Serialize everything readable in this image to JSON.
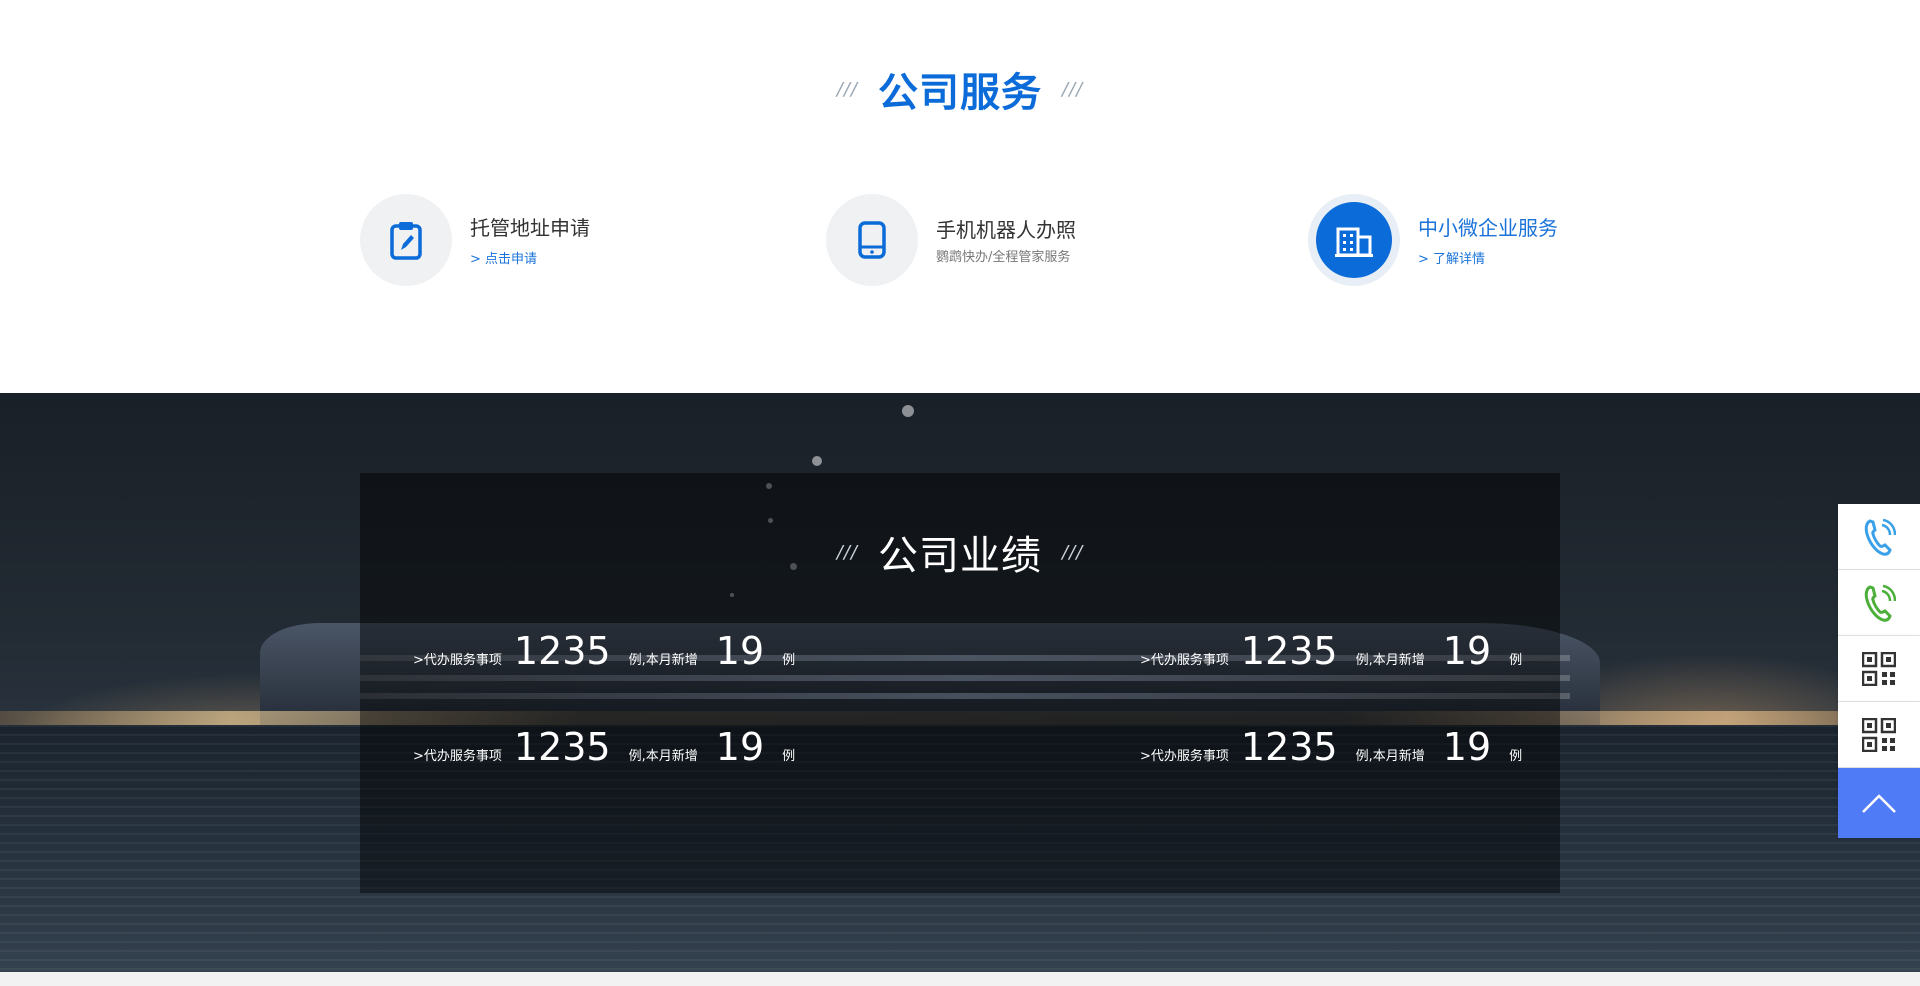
{
  "services": {
    "title": "公司服务",
    "slashes": "///",
    "items": [
      {
        "title": "托管地址申请",
        "link": "> 点击申请",
        "icon": "clipboard-pen-icon"
      },
      {
        "title": "手机机器人办照",
        "subtitle": "鹦鹉快办/全程管家服务",
        "icon": "tablet-icon"
      },
      {
        "title": "中小微企业服务",
        "link": "> 了解详情",
        "icon": "building-icon"
      }
    ]
  },
  "performance": {
    "title": "公司业绩",
    "slashes": "///",
    "stats": [
      {
        "label": ">代办服务事项",
        "total": "1235",
        "mid": "例,本月新增",
        "new": "19",
        "unit": "例"
      },
      {
        "label": ">代办服务事项",
        "total": "1235",
        "mid": "例,本月新增",
        "new": "19",
        "unit": "例"
      },
      {
        "label": ">代办服务事项",
        "total": "1235",
        "mid": "例,本月新增",
        "new": "19",
        "unit": "例"
      },
      {
        "label": ">代办服务事项",
        "total": "1235",
        "mid": "例,本月新增",
        "new": "19",
        "unit": "例"
      }
    ]
  },
  "sidebar": {
    "buttons": [
      {
        "icon": "phone-icon",
        "color": "#3aa0e8"
      },
      {
        "icon": "phone-icon",
        "color": "#4caf3a"
      },
      {
        "icon": "qrcode-icon",
        "color": "#333333"
      },
      {
        "icon": "qrcode-icon",
        "color": "#333333"
      },
      {
        "icon": "chevron-up-icon",
        "color": "#ffffff"
      }
    ]
  },
  "colors": {
    "accent": "#0b6bd8",
    "back_to_top": "#4f7cf6"
  }
}
